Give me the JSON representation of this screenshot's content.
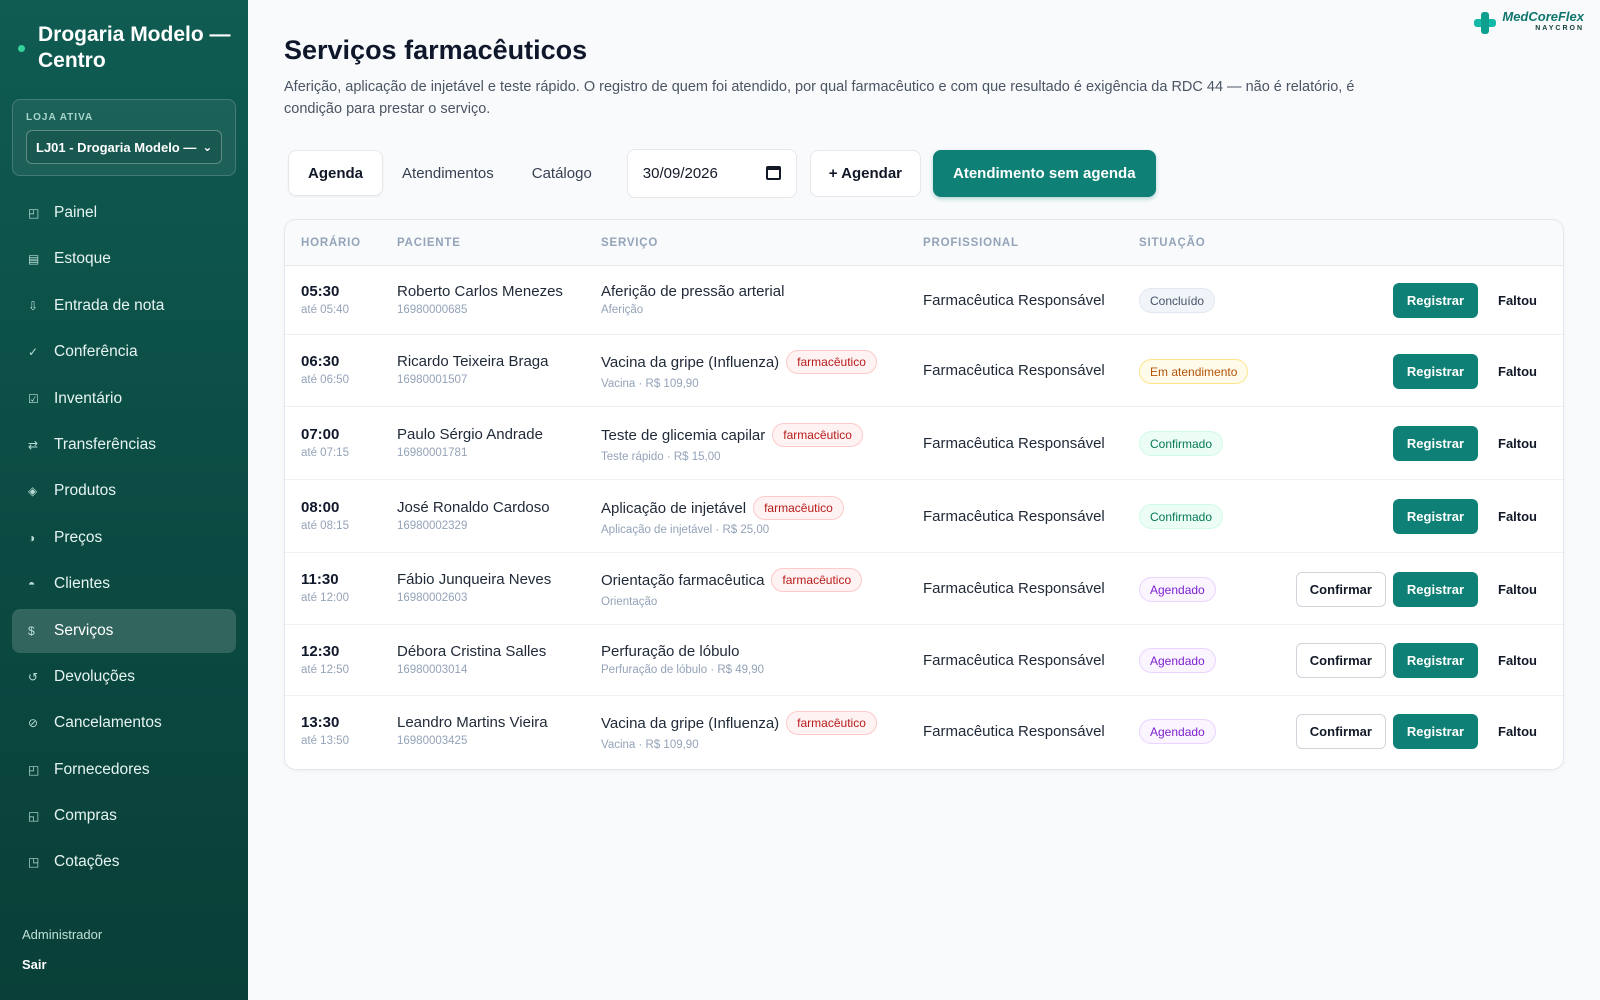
{
  "sidebar": {
    "brand": "Drogaria Modelo — Centro",
    "store_label": "LOJA ATIVA",
    "store_value": "LJ01 - Drogaria Modelo —",
    "items": [
      {
        "label": "Painel",
        "icon": "dashboard-icon",
        "glyph": "◰"
      },
      {
        "label": "Estoque",
        "icon": "stock-icon",
        "glyph": "▤"
      },
      {
        "label": "Entrada de nota",
        "icon": "download-icon",
        "glyph": "⇩"
      },
      {
        "label": "Conferência",
        "icon": "check-icon",
        "glyph": "✓"
      },
      {
        "label": "Inventário",
        "icon": "checkbox-icon",
        "glyph": "☑"
      },
      {
        "label": "Transferências",
        "icon": "transfer-icon",
        "glyph": "⇄"
      },
      {
        "label": "Produtos",
        "icon": "product-icon",
        "glyph": "◈"
      },
      {
        "label": "Preços",
        "icon": "price-icon",
        "glyph": "◑"
      },
      {
        "label": "Clientes",
        "icon": "customer-icon",
        "glyph": "◓"
      },
      {
        "label": "Serviços",
        "icon": "service-icon",
        "glyph": "$"
      },
      {
        "label": "Devoluções",
        "icon": "return-icon",
        "glyph": "↺"
      },
      {
        "label": "Cancelamentos",
        "icon": "cancel-icon",
        "glyph": "⊘"
      },
      {
        "label": "Fornecedores",
        "icon": "supplier-icon",
        "glyph": "◰"
      },
      {
        "label": "Compras",
        "icon": "purchase-icon",
        "glyph": "◱"
      },
      {
        "label": "Cotações",
        "icon": "quote-icon",
        "glyph": "◳"
      }
    ],
    "active_index": 9,
    "user": "Administrador",
    "logout": "Sair"
  },
  "logo": {
    "main": "MedCoreFlex",
    "sub": "NAYCRON"
  },
  "page": {
    "title": "Serviços farmacêuticos",
    "description": "Aferição, aplicação de injetável e teste rápido. O registro de quem foi atendido, por qual farmacêutico e com que resultado é exigência da RDC 44 — não é relatório, é condição para prestar o serviço."
  },
  "toolbar": {
    "tabs": [
      "Agenda",
      "Atendimentos",
      "Catálogo"
    ],
    "active_tab": 0,
    "date": "30/09/2026",
    "schedule_label": "+ Agendar",
    "walkin_label": "Atendimento sem agenda"
  },
  "table": {
    "headers": [
      "HORÁRIO",
      "PACIENTE",
      "SERVIÇO",
      "PROFISSIONAL",
      "SITUAÇÃO"
    ],
    "confirm_label": "Confirmar",
    "register_label": "Registrar",
    "miss_label": "Faltou",
    "rows": [
      {
        "time": "05:30",
        "until": "até 05:40",
        "patient": "Roberto Carlos Menezes",
        "pid": "16980000685",
        "service": "Aferição de pressão arterial",
        "tag": "",
        "svc_sub": "Aferição",
        "prof": "Farmacêutica Responsável",
        "status": "Concluído",
        "status_type": "concluido",
        "confirm": false
      },
      {
        "time": "06:30",
        "until": "até 06:50",
        "patient": "Ricardo Teixeira Braga",
        "pid": "16980001507",
        "service": "Vacina da gripe (Influenza)",
        "tag": "farmacêutico",
        "svc_sub": "Vacina · R$ 109,90",
        "prof": "Farmacêutica Responsável",
        "status": "Em atendimento",
        "status_type": "atendimento",
        "confirm": false
      },
      {
        "time": "07:00",
        "until": "até 07:15",
        "patient": "Paulo Sérgio Andrade",
        "pid": "16980001781",
        "service": "Teste de glicemia capilar",
        "tag": "farmacêutico",
        "svc_sub": "Teste rápido · R$ 15,00",
        "prof": "Farmacêutica Responsável",
        "status": "Confirmado",
        "status_type": "confirmado",
        "confirm": false
      },
      {
        "time": "08:00",
        "until": "até 08:15",
        "patient": "José Ronaldo Cardoso",
        "pid": "16980002329",
        "service": "Aplicação de injetável",
        "tag": "farmacêutico",
        "svc_sub": "Aplicação de injetável · R$ 25,00",
        "prof": "Farmacêutica Responsável",
        "status": "Confirmado",
        "status_type": "confirmado",
        "confirm": false
      },
      {
        "time": "11:30",
        "until": "até 12:00",
        "patient": "Fábio Junqueira Neves",
        "pid": "16980002603",
        "service": "Orientação farmacêutica",
        "tag": "farmacêutico",
        "svc_sub": "Orientação",
        "prof": "Farmacêutica Responsável",
        "status": "Agendado",
        "status_type": "agendado",
        "confirm": true
      },
      {
        "time": "12:30",
        "until": "até 12:50",
        "patient": "Débora Cristina Salles",
        "pid": "16980003014",
        "service": "Perfuração de lóbulo",
        "tag": "",
        "svc_sub": "Perfuração de lóbulo · R$ 49,90",
        "prof": "Farmacêutica Responsável",
        "status": "Agendado",
        "status_type": "agendado",
        "confirm": true
      },
      {
        "time": "13:30",
        "until": "até 13:50",
        "patient": "Leandro Martins Vieira",
        "pid": "16980003425",
        "service": "Vacina da gripe (Influenza)",
        "tag": "farmacêutico",
        "svc_sub": "Vacina · R$ 109,90",
        "prof": "Farmacêutica Responsável",
        "status": "Agendado",
        "status_type": "agendado",
        "confirm": true
      }
    ]
  }
}
